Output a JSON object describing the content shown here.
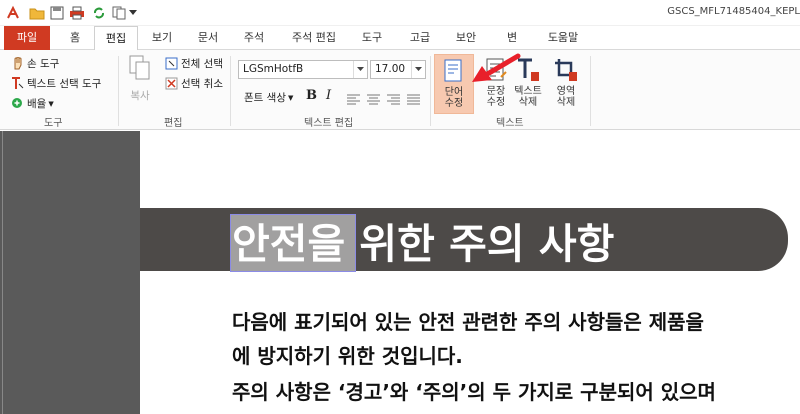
{
  "window": {
    "doc_title": "GSCS_MFL71485404_KEPL"
  },
  "tabs": [
    {
      "label": "파일"
    },
    {
      "label": "홈"
    },
    {
      "label": "편집"
    },
    {
      "label": "보기"
    },
    {
      "label": "문서"
    },
    {
      "label": "주석"
    },
    {
      "label": "주석 편집"
    },
    {
      "label": "도구"
    },
    {
      "label": "고급"
    },
    {
      "label": "보안"
    },
    {
      "label": "변"
    },
    {
      "label": "도움말"
    }
  ],
  "ribbon": {
    "tools": {
      "hand": "손 도구",
      "text_select": "텍스트 선택 도구",
      "zoom": "배율",
      "group": "도구"
    },
    "edit": {
      "copy": "복사",
      "select_all": "전체 선택",
      "deselect": "선택 취소",
      "group": "편집"
    },
    "text_edit": {
      "font": "LGSmHotfB",
      "size": "17.00",
      "font_color": "폰트 색상",
      "bold": "B",
      "italic": "I",
      "group": "텍스트 편집"
    },
    "text": {
      "word_edit": [
        "단어",
        "수정"
      ],
      "sentence_edit": [
        "문장",
        "수정"
      ],
      "text_delete": [
        "텍스트",
        "삭제"
      ],
      "area_delete": [
        "영역",
        "삭제"
      ],
      "group": "텍스트"
    }
  },
  "document": {
    "heading": "안전을 위한 주의 사항",
    "para1_line1": "다음에 표기되어 있는 안전 관련한 주의 사항들은 제품을 ",
    "para1_line2": "에 방지하기 위한 것입니다.",
    "para2": "주의 사항은 ‘경고’와 ‘주의’의 두 가지로 구분되어 있으며"
  },
  "colors": {
    "file_tab": "#d03a22",
    "banner": "#4d4a48",
    "selected_button": "#f7c9b0",
    "arrow": "#e8202a"
  }
}
